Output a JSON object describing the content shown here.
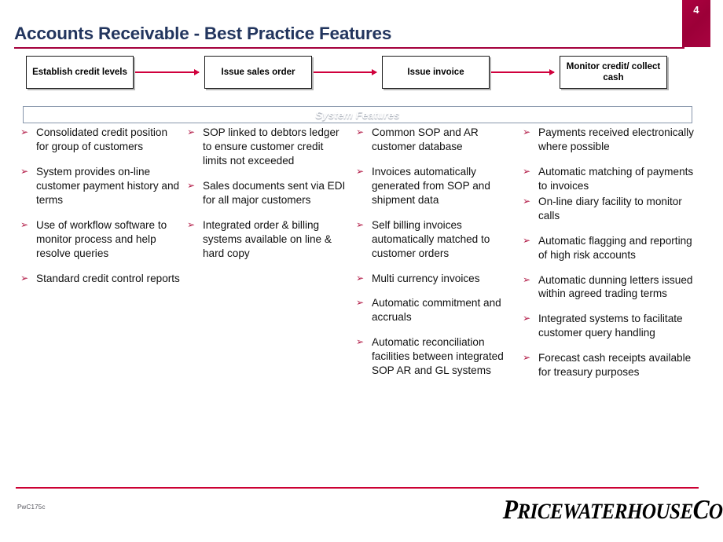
{
  "slide": {
    "page_number": "4",
    "title": "Accounts Receivable - Best Practice Features"
  },
  "process_flow": {
    "boxes": [
      {
        "label": "Establish credit levels"
      },
      {
        "label": "Issue sales order"
      },
      {
        "label": "Issue invoice"
      },
      {
        "label": "Monitor credit/ collect cash"
      }
    ],
    "arrow_color": "#d0003c"
  },
  "features": {
    "banner_label": "System Features",
    "bullet_marker": "➢",
    "columns": [
      {
        "items": [
          {
            "text": "Consolidated credit position for group of customers",
            "tight": false
          },
          {
            "text": "System provides on-line customer payment history and terms",
            "tight": false
          },
          {
            "text": "Use of workflow software to monitor process and help resolve queries",
            "tight": false
          },
          {
            "text": "Standard credit control reports",
            "tight": false
          }
        ]
      },
      {
        "items": [
          {
            "text": "SOP linked to debtors ledger to ensure customer credit limits not exceeded",
            "tight": false
          },
          {
            "text": "Sales documents sent via EDI for all major customers",
            "tight": false
          },
          {
            "text": "Integrated order & billing systems available on line & hard copy",
            "tight": false
          }
        ]
      },
      {
        "items": [
          {
            "text": "Common SOP and AR customer database",
            "tight": false
          },
          {
            "text": "Invoices automatically generated from SOP and shipment data",
            "tight": false
          },
          {
            "text": "Self billing invoices automatically matched to customer orders",
            "tight": false
          },
          {
            "text": "Multi currency invoices",
            "tight": false
          },
          {
            "text": "Automatic commitment and accruals",
            "tight": false
          },
          {
            "text": "Automatic reconciliation facilities between integrated SOP AR and GL systems",
            "tight": false
          }
        ]
      },
      {
        "items": [
          {
            "text": "Payments received electronically where possible",
            "tight": false
          },
          {
            "text": "Automatic matching of payments to invoices",
            "tight": true
          },
          {
            "text": "On-line diary facility to monitor calls",
            "tight": false
          },
          {
            "text": "Automatic flagging and reporting of high risk accounts",
            "tight": false
          },
          {
            "text": "Automatic dunning letters issued within agreed trading terms",
            "tight": false
          },
          {
            "text": "Integrated systems to facilitate customer query handling",
            "tight": false
          },
          {
            "text": "Forecast cash receipts available for treasury purposes",
            "tight": false
          }
        ]
      }
    ]
  },
  "footer": {
    "code": "PwC175c",
    "logo_text": "PricewaterhouseCoopers",
    "logo_registered_mark": "R"
  },
  "colors": {
    "title": "#22355e",
    "accent_rule": "#a4003c",
    "page_tab": "#a4003c",
    "bullet_marker": "#b01542",
    "footer_rule": "#cc0033"
  }
}
